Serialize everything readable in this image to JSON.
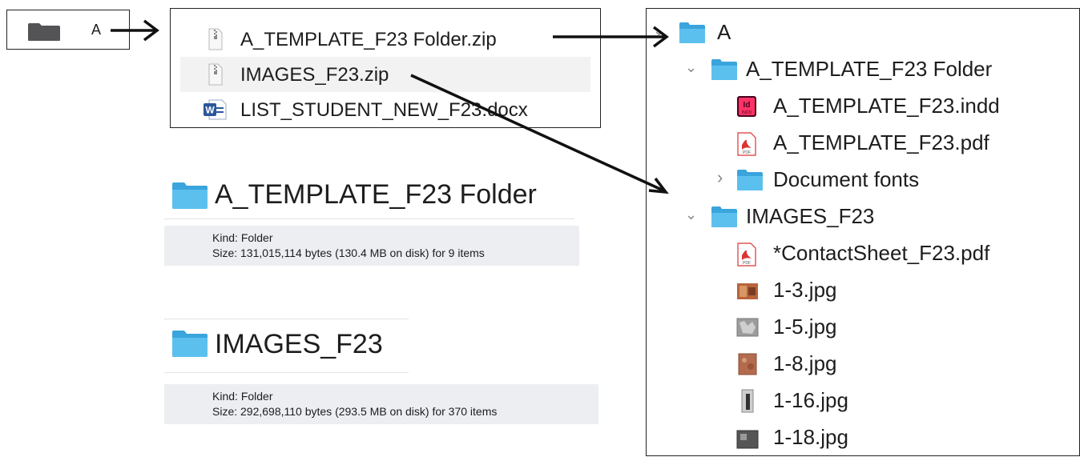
{
  "box_a": {
    "label": "A"
  },
  "zip_listing": {
    "items": [
      {
        "name": "A_TEMPLATE_F23 Folder.zip",
        "icon": "zip-file-icon"
      },
      {
        "name": "IMAGES_F23.zip",
        "icon": "zip-file-icon",
        "selected": true
      },
      {
        "name": "LIST_STUDENT_NEW_F23.docx",
        "icon": "word-doc-icon"
      }
    ]
  },
  "info_template": {
    "title": "A_TEMPLATE_F23 Folder",
    "kind_label": "Kind:",
    "kind_value": "Folder",
    "size_label": "Size:",
    "size_value": "131,015,114 bytes (130.4 MB on disk) for 9 items"
  },
  "info_images": {
    "title": "IMAGES_F23",
    "kind_label": "Kind:",
    "kind_value": "Folder",
    "size_label": "Size:",
    "size_value": "292,698,110 bytes (293.5 MB on disk) for 370 items"
  },
  "tree": {
    "rows": [
      {
        "name": "A",
        "icon": "folder-icon",
        "chevron": "expanded"
      },
      {
        "name": "A_TEMPLATE_F23 Folder",
        "icon": "folder-icon",
        "chevron": "expanded"
      },
      {
        "name": "A_TEMPLATE_F23.indd",
        "icon": "indesign-file-icon",
        "chevron": "none"
      },
      {
        "name": "A_TEMPLATE_F23.pdf",
        "icon": "pdf-file-icon",
        "chevron": "none"
      },
      {
        "name": "Document fonts",
        "icon": "folder-icon",
        "chevron": "collapsed"
      },
      {
        "name": "IMAGES_F23",
        "icon": "folder-icon",
        "chevron": "expanded"
      },
      {
        "name": "*ContactSheet_F23.pdf",
        "icon": "pdf-file-icon",
        "chevron": "none"
      },
      {
        "name": "1-3.jpg",
        "icon": "image-thumbnail-icon",
        "chevron": "none"
      },
      {
        "name": "1-5.jpg",
        "icon": "image-thumbnail-icon",
        "chevron": "none"
      },
      {
        "name": "1-8.jpg",
        "icon": "image-thumbnail-icon",
        "chevron": "none"
      },
      {
        "name": "1-16.jpg",
        "icon": "image-thumbnail-icon",
        "chevron": "none"
      },
      {
        "name": "1-18.jpg",
        "icon": "image-thumbnail-icon",
        "chevron": "none"
      }
    ]
  },
  "colors": {
    "folder_blue": "#4bb3e8",
    "folder_dark": "#545457",
    "selection": "#f2f2f3",
    "info_panel": "#eceef1",
    "arrow": "#111111"
  }
}
